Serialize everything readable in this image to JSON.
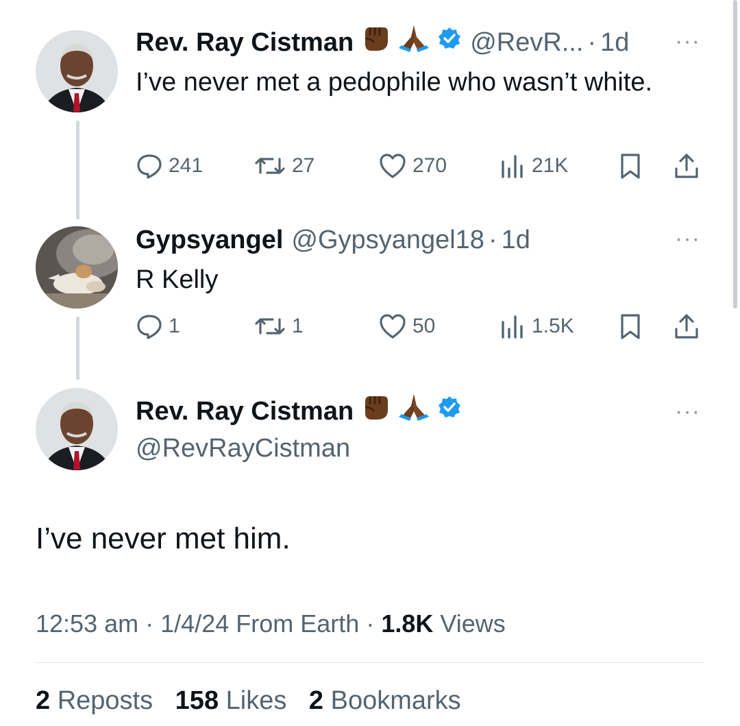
{
  "tweet1": {
    "name": "Rev. Ray Cistman",
    "emojis": [
      "raised-fist-icon",
      "folded-hands-icon"
    ],
    "handle": "@RevR...",
    "time": "1d",
    "text": "I’ve never met a pedophile who wasn’t white.",
    "replies": "241",
    "reposts": "27",
    "likes": "270",
    "views": "21K"
  },
  "tweet2": {
    "name": "Gypsyangel",
    "handle": "@Gypsyangel18",
    "time": "1d",
    "text": "R Kelly",
    "replies": "1",
    "reposts": "1",
    "likes": "50",
    "views": "1.5K"
  },
  "main": {
    "name": "Rev. Ray Cistman",
    "handle": "@RevRayCistman",
    "text": "I’ve never met him.",
    "time": "12:53 am",
    "date": "1/4/24",
    "source": "From Earth",
    "views_count": "1.8K",
    "views_label": "Views",
    "reposts_count": "2",
    "reposts_label": "Reposts",
    "likes_count": "158",
    "likes_label": "Likes",
    "bookmarks_count": "2",
    "bookmarks_label": "Bookmarks"
  },
  "separator": "·",
  "more_glyph": "···",
  "colors": {
    "verified": "#1d9bf0",
    "muted": "#536471",
    "thread_line": "#cfd9de"
  }
}
